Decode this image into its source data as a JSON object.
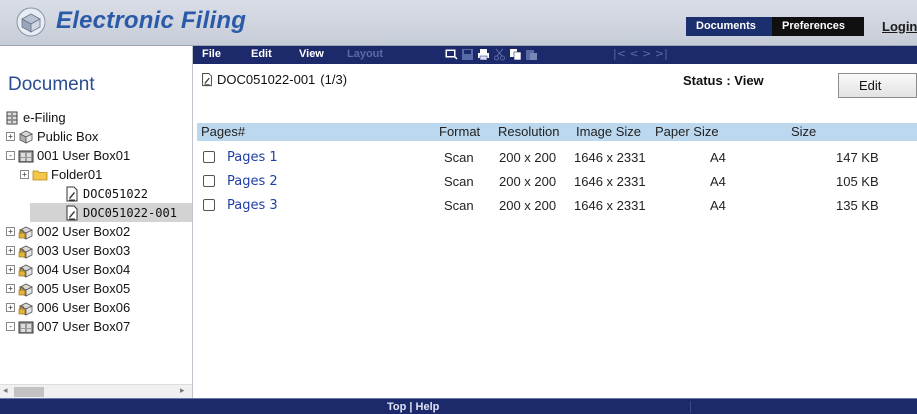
{
  "header": {
    "app_title": "Electronic Filing",
    "tabs": {
      "documents": "Documents",
      "preferences": "Preferences"
    },
    "login": "Login"
  },
  "toolbar": {
    "menu": {
      "file": "File",
      "edit": "Edit",
      "view": "View",
      "layout": "Layout"
    },
    "nav_arrows": "|<   <   >   >|"
  },
  "left_panel": {
    "title": "Document",
    "tree": [
      {
        "label": "e-Filing",
        "icon": "cabinet-icon",
        "expander": ""
      },
      {
        "label": "Public Box",
        "icon": "box-icon",
        "expander": "+"
      },
      {
        "label": "001 User Box01",
        "icon": "user-box-icon",
        "expander": "-"
      },
      {
        "label": "Folder01",
        "icon": "folder-icon",
        "expander": "+"
      },
      {
        "label": "DOC051022",
        "icon": "document-icon",
        "expander": ""
      },
      {
        "label": "DOC051022-001",
        "icon": "document-icon",
        "expander": "",
        "selected": true
      },
      {
        "label": "002 User Box02",
        "icon": "locked-box-icon",
        "expander": "+"
      },
      {
        "label": "003 User Box03",
        "icon": "locked-box-icon",
        "expander": "+"
      },
      {
        "label": "004 User Box04",
        "icon": "locked-box-icon",
        "expander": "+"
      },
      {
        "label": "005 User Box05",
        "icon": "locked-box-icon",
        "expander": "+"
      },
      {
        "label": "006 User Box06",
        "icon": "locked-box-icon",
        "expander": "+"
      },
      {
        "label": "007 User Box07",
        "icon": "user-box-icon",
        "expander": "-"
      }
    ]
  },
  "document": {
    "name": "DOC051022-001",
    "page_count": "(1/3)",
    "status": "Status : View",
    "edit_button": "Edit"
  },
  "table": {
    "headers": [
      "Pages#",
      "Format",
      "Resolution",
      "Image Size",
      "Paper Size",
      "Size"
    ],
    "rows": [
      {
        "page": "Pages 1",
        "format": "Scan",
        "resolution": "200 x 200",
        "image_size": "1646 x 2331",
        "paper_size": "A4",
        "size": "147 KB"
      },
      {
        "page": "Pages 2",
        "format": "Scan",
        "resolution": "200 x 200",
        "image_size": "1646 x 2331",
        "paper_size": "A4",
        "size": "105 KB"
      },
      {
        "page": "Pages 3",
        "format": "Scan",
        "resolution": "200 x 200",
        "image_size": "1646 x 2331",
        "paper_size": "A4",
        "size": "135 KB"
      }
    ]
  },
  "footer": {
    "links": "Top | Help"
  },
  "colors": {
    "navy": "#1c2a6b",
    "title_blue": "#2a5aa8",
    "table_header": "#bcd8ef",
    "link_blue": "#1f3fa8"
  }
}
